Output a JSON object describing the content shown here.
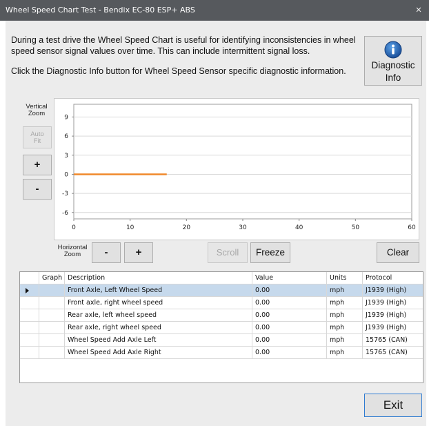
{
  "window": {
    "title": "Wheel Speed Chart Test - Bendix EC-80 ESP+ ABS",
    "close_glyph": "×"
  },
  "intro": {
    "line1": "During a test drive the Wheel Speed Chart is useful for identifying inconsistencies in wheel speed sensor signal values over time. This can include intermittent signal loss.",
    "line2": "Click the Diagnostic Info button for Wheel Speed Sensor specific diagnostic information."
  },
  "diagnostic_button": {
    "line1": "Diagnostic",
    "line2": "Info",
    "icon": "info-icon"
  },
  "vertical_zoom": {
    "line1": "Vertical",
    "line2": "Zoom",
    "autofit_line1": "Auto",
    "autofit_line2": "Fit",
    "plus": "+",
    "minus": "-"
  },
  "horizontal_zoom": {
    "line1": "Horizontal",
    "line2": "Zoom",
    "minus": "-",
    "plus": "+"
  },
  "chart_controls": {
    "scroll": "Scroll",
    "freeze": "Freeze",
    "clear": "Clear"
  },
  "chart_data": {
    "type": "line",
    "x_ticks": [
      "0",
      "10",
      "20",
      "30",
      "40",
      "50",
      "60"
    ],
    "y_ticks": [
      "9",
      "6",
      "3",
      "0",
      "-3",
      "-6"
    ],
    "xlim": [
      0,
      60
    ],
    "ylim": [
      -7,
      11
    ],
    "grid": "horizontal",
    "series": [
      {
        "color": "#f0882a",
        "x": [
          0,
          16.5
        ],
        "y": [
          0,
          0
        ]
      }
    ]
  },
  "table": {
    "headers": {
      "graph": "Graph",
      "description": "Description",
      "value": "Value",
      "units": "Units",
      "protocol": "Protocol"
    },
    "rows": [
      {
        "description": "Front Axle, Left Wheel Speed",
        "value": "0.00",
        "units": "mph",
        "protocol": "J1939 (High)"
      },
      {
        "description": "Front axle, right wheel speed",
        "value": "0.00",
        "units": "mph",
        "protocol": "J1939 (High)"
      },
      {
        "description": "Rear axle, left wheel speed",
        "value": "0.00",
        "units": "mph",
        "protocol": "J1939 (High)"
      },
      {
        "description": "Rear axle, right wheel speed",
        "value": "0.00",
        "units": "mph",
        "protocol": "J1939 (High)"
      },
      {
        "description": "Wheel Speed Add Axle Left",
        "value": "0.00",
        "units": "mph",
        "protocol": "15765 (CAN)"
      },
      {
        "description": "Wheel Speed Add Axle Right",
        "value": "0.00",
        "units": "mph",
        "protocol": "15765 (CAN)"
      }
    ]
  },
  "exit_button": "Exit",
  "colors": {
    "titlebar": "#56595d",
    "client": "#ececec",
    "selected_row": "#c6d9ec",
    "series": "#f0882a",
    "exit_border": "#2e7bd1"
  }
}
